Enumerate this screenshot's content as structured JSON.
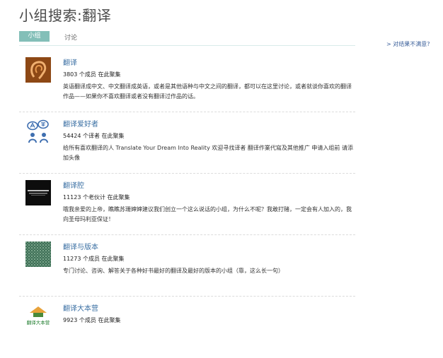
{
  "page_title": "小组搜索:翻译",
  "tabs": [
    {
      "label": "小组"
    },
    {
      "label": "讨论"
    }
  ],
  "feedback_link": "> 对结果不满意?",
  "groups": [
    {
      "name": "翻译",
      "members": "3803 个成员 在此聚集",
      "description": "英语翻译成中文、中文翻译成英语，或者是其他语种与中文之间的翻译，都可以在这里讨论，或者就谈你喜欢的翻译作品——如果你不喜欢翻译或者没有翻译过作品的话。",
      "icon": "ear-image"
    },
    {
      "name": "翻译爱好者",
      "members": "54424 个译者 在此聚集",
      "description": "给所有喜欢翻译的人 Translate Your Dream Into Reality 欢迎寻找译者 翻译作業代寫及其他推广 申请入组前 请添加头像",
      "icon": "translate-icon"
    },
    {
      "name": "翻译腔",
      "members": "11123 个老伙计 在此聚集",
      "description": "哦我亲爱的上帝，瞧瞧苏珊婶婶建议我们创立一个这么说话的小组，为什么不呢？我敢打赌，一定会有人加入的，我向圣母玛利亚保证！",
      "icon": "dark-banner-image"
    },
    {
      "name": "翻译与版本",
      "members": "11273 个成员 在此聚集",
      "description": "专门讨论、咨询、解答关于各种好书最好的翻译及最好的版本的小组（靠，这么长一句）",
      "icon": "pattern-image"
    },
    {
      "name": "翻译大本营",
      "members": "9923 个成员 在此聚集",
      "description": "",
      "icon": "camp-logo",
      "logo_text": "翻译大本营"
    }
  ],
  "colors": {
    "tab_active_bg": "#83bfb8",
    "link": "#3a6fa3"
  }
}
